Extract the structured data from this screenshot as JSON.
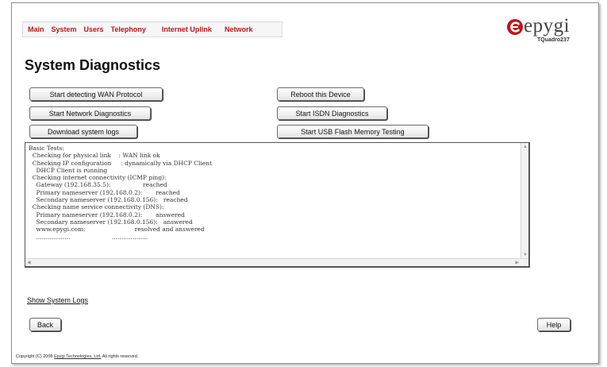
{
  "nav": {
    "items": [
      "Main",
      "System",
      "Users",
      "Telephony",
      "Internet Uplink",
      "Network"
    ]
  },
  "logo": {
    "brand": "epygi",
    "model": "TQuadro237",
    "color": "#c0141a"
  },
  "page": {
    "title": "System Diagnostics"
  },
  "buttons": {
    "wan": "Start detecting WAN Protocol",
    "reboot": "Reboot this Device",
    "netdiag": "Start Network Diagnostics",
    "isdn": "Start ISDN Diagnostics",
    "logs": "Download system logs",
    "usb": "Start USB Flash Memory Testing",
    "back": "Back",
    "help": "Help"
  },
  "output": {
    "text": "Basic Tests:\n  Checking for physical link    : WAN link ok\n  Checking IP configuration     : dynamically via DHCP Client\n    DHCP Client is running\n  Checking internet connectivity (ICMP ping):\n    Gateway (192.168.35.5):                 reached\n    Primary nameserver (192.168.0.2):       reached\n    Secondary nameserver (192.168.0.156):   reached\n  Checking name service connectivity (DNS):\n    Primary nameserver (192.168.0.2):       answered\n    Secondary nameserver (192.168.0.156):   answered\n    www.epygi.com:                          resolved and answered\n    ..................                      ..................."
  },
  "links": {
    "show_logs": "Show System Logs"
  },
  "footer": {
    "prefix": "Copyright (C) 2008 ",
    "company": "Epygi Technologies, Ltd.",
    "suffix": " All rights reserved."
  }
}
